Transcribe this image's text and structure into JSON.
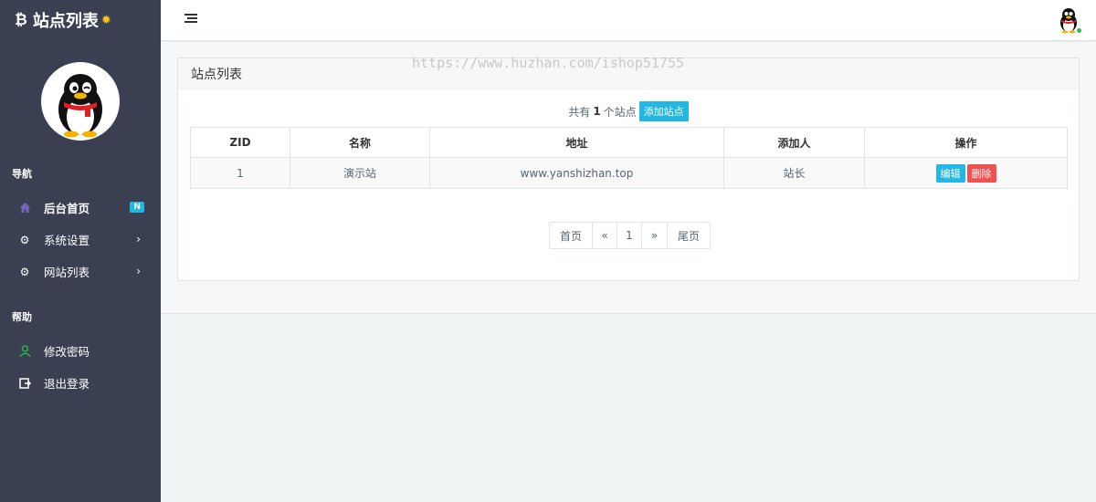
{
  "sidebar": {
    "brand_icon": "₿",
    "brand_title": "站点列表",
    "brand_gear": "✹",
    "sections": {
      "nav": "导航",
      "help": "帮助"
    },
    "items": [
      {
        "label": "后台首页",
        "icon": "home-icon",
        "glyph": "⌂",
        "badge": "N"
      },
      {
        "label": "系统设置",
        "icon": "gear-icon",
        "glyph": "⚙",
        "chevron": "›"
      },
      {
        "label": "网站列表",
        "icon": "gear-icon",
        "glyph": "⚙",
        "chevron": "›"
      },
      {
        "label": "修改密码",
        "icon": "user-icon",
        "glyph": "♙"
      },
      {
        "label": "退出登录",
        "icon": "logout-icon",
        "glyph": "⇲"
      }
    ]
  },
  "panel": {
    "title": "站点列表",
    "watermark": "https://www.huzhan.com/ishop51755",
    "summary_prefix": "共有",
    "summary_count": "1",
    "summary_suffix": "个站点",
    "add_button": "添加站点"
  },
  "table": {
    "headers": [
      "ZID",
      "名称",
      "地址",
      "添加人",
      "操作"
    ],
    "rows": [
      {
        "zid": "1",
        "name": "演示站",
        "address": "www.yanshizhan.top",
        "adder": "站长",
        "edit": "编辑",
        "delete": "删除"
      }
    ]
  },
  "pagination": {
    "first": "首页",
    "prev": "«",
    "current": "1",
    "next": "»",
    "last": "尾页"
  },
  "colors": {
    "sidebar_bg": "#3a3f51",
    "accent": "#23b7e5",
    "danger": "#f05050",
    "online": "#27c24c"
  }
}
